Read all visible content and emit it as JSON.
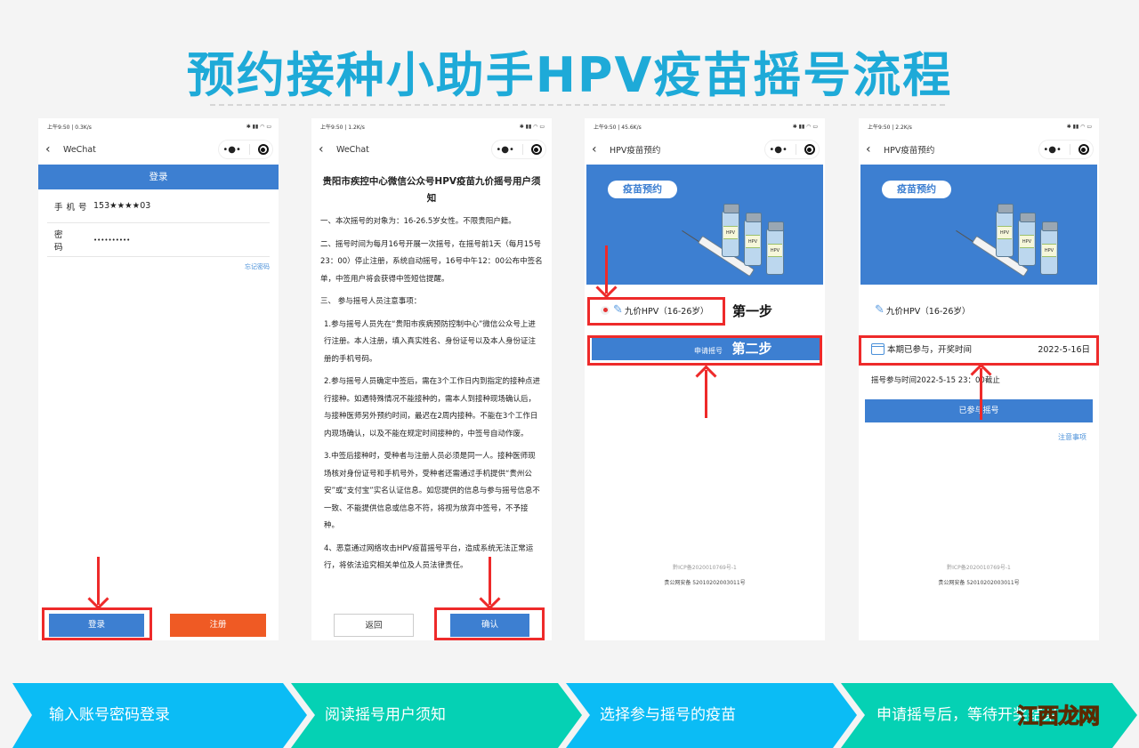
{
  "page_title": "预约接种小助手HPV疫苗摇号流程",
  "colors": {
    "title": "#1eaad8",
    "wechat_blue": "#3d7fd1",
    "register_orange": "#ef5a24",
    "highlight_red": "#ee2a2a",
    "flow_blue": "#0bbcf5",
    "flow_teal": "#05d1b4"
  },
  "screens": [
    {
      "status_bar": {
        "time": "上午9:50 | 0.3K/s",
        "icons": "bluetooth-icon signal-icon wifi-icon battery-icon"
      },
      "nav": {
        "back_icon": "chevron-left-icon",
        "title": "WeChat",
        "more_icon": "more-dots-icon",
        "close_icon": "target-close-icon"
      },
      "header": "登录",
      "fields": [
        {
          "label": "手机号",
          "value": "153★★★★03"
        },
        {
          "label": "密码",
          "value": "••••••••••"
        }
      ],
      "forgot_password": "忘记密码",
      "login_button": "登录",
      "register_button": "注册"
    },
    {
      "status_bar": {
        "time": "上午9:50 | 1.2K/s"
      },
      "nav": {
        "title": "WeChat"
      },
      "notice_title": "贵阳市疾控中心微信公众号HPV疫苗九价摇号用户须知",
      "paragraphs": [
        "一、本次摇号的对象为：16-26.5岁女性。不限贵阳户籍。",
        "二、摇号时间为每月16号开展一次摇号，在摇号前1天（每月15号23：00）停止注册，系统自动摇号，16号中午12：00公布中签名单，中签用户将会获得中签短信提醒。",
        "三、 参与摇号人员注意事项：",
        "1.参与摇号人员先在“贵阳市疾病预防控制中心”微信公众号上进行注册。本人注册，填入真实姓名、身份证号以及本人身份证注册的手机号码。",
        "2.参与摇号人员确定中签后，需在3个工作日内到指定的接种点进行接种。如遇特殊情况不能接种的，需本人到接种现场确认后，与接种医师另外预约时间，最迟在2周内接种。不能在3个工作日内现场确认，以及不能在规定时间接种的，中签号自动作废。",
        "3.中签后接种时，受种者与注册人员必须是同一人。接种医师现场核对身份证号和手机号外，受种者还需通过手机提供“贵州公安”或“支付宝”实名认证信息。如您提供的信息与参与摇号信息不一致、不能提供信息或信息不符，将视为放弃中签号，不予接种。",
        "4、恶意通过网络攻击HPV疫苗摇号平台，造成系统无法正常运行，将依法追究相关单位及人员法律责任。"
      ],
      "back_button": "返回",
      "confirm_button": "确认"
    },
    {
      "status_bar": {
        "time": "上午9:50 | 45.6K/s"
      },
      "nav": {
        "title": "HPV疫苗预约"
      },
      "banner_label": "疫苗预约",
      "vial_label": "HPV",
      "vaccine_option": "九价HPV（16-26岁）",
      "vaccine_selected": true,
      "apply_button": "申请摇号",
      "step1_annotation": "第一步",
      "step2_annotation": "第二步",
      "icp": "黔ICP备2020010769号-1",
      "gongan": "贵公网安备 52010202003011号"
    },
    {
      "status_bar": {
        "time": "上午9:50 | 2.2K/s"
      },
      "nav": {
        "title": "HPV疫苗预约"
      },
      "banner_label": "疫苗预约",
      "vaccine_option": "九价HPV（16-26岁）",
      "participated_label": "本期已参与，开奖时间",
      "draw_date": "2022-5-16日",
      "deadline": "摇号参与时间2022-5-15 23：00截止",
      "joined_button": "已参与摇号",
      "notes_link": "注意事项",
      "icp": "黔ICP备2020010769号-1",
      "gongan": "贵公网安备 52010202003011号"
    }
  ],
  "flow_steps": [
    "输入账号密码登录",
    "阅读摇号用户须知",
    "选择参与摇号的疫苗",
    "申请摇号后，等待开奖结果"
  ],
  "watermark": "江西龙网"
}
